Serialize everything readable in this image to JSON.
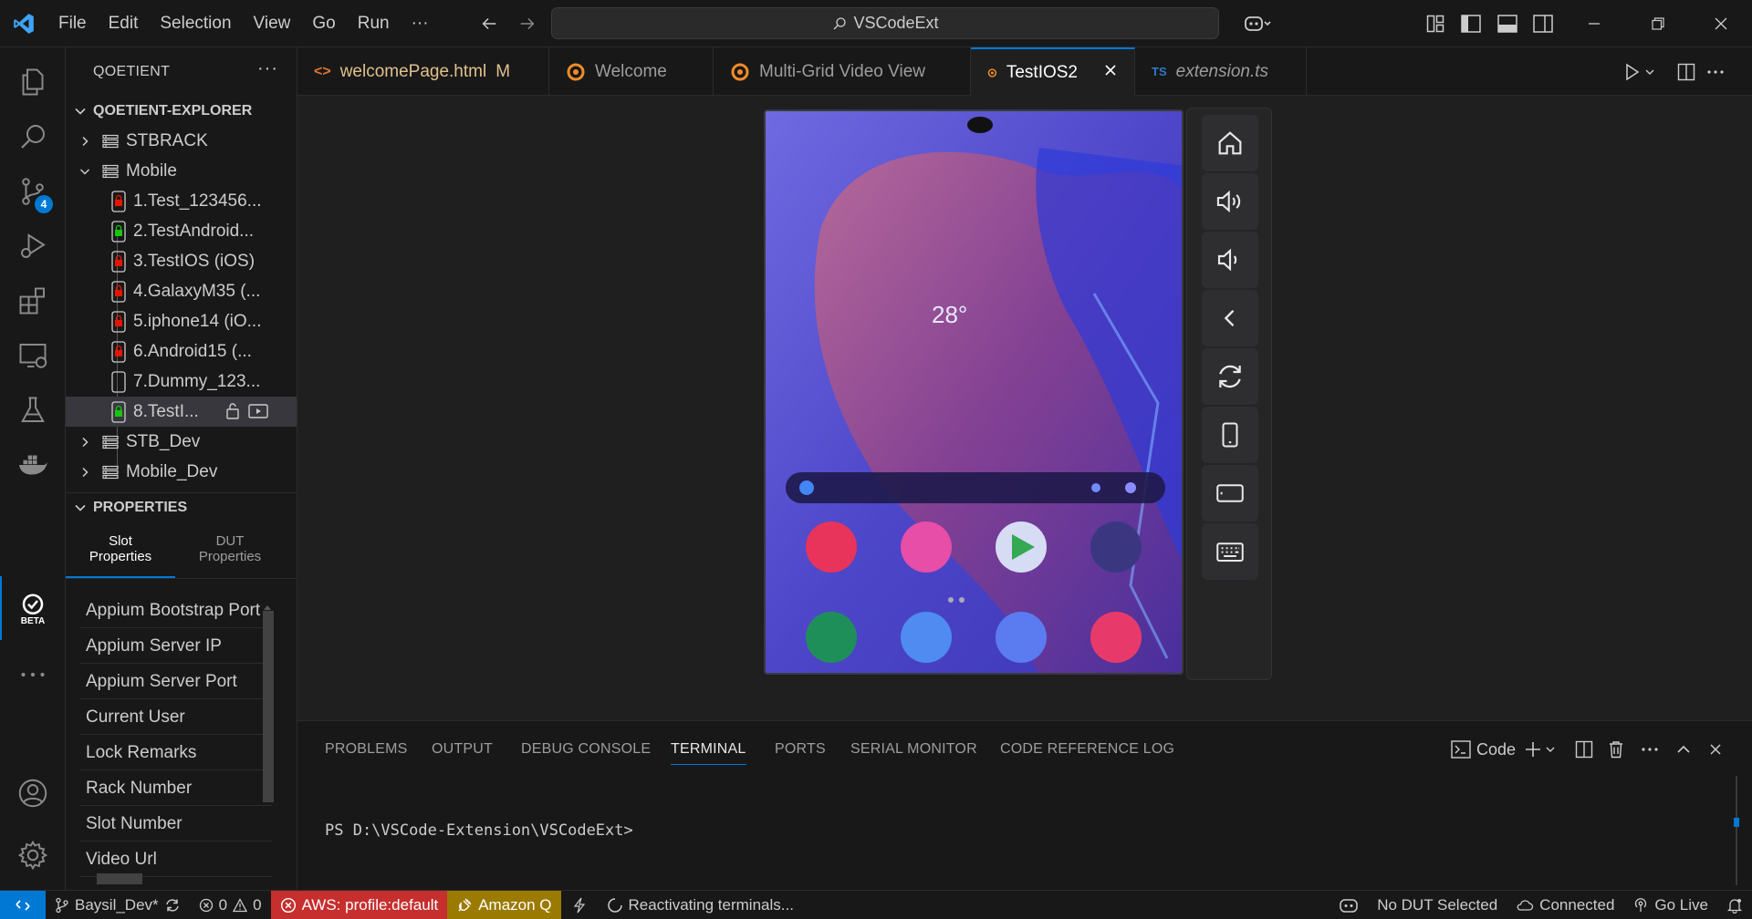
{
  "menu": [
    "File",
    "Edit",
    "Selection",
    "View",
    "Go",
    "Run",
    "···"
  ],
  "search": {
    "text": "VSCodeExt"
  },
  "activity": {
    "scm_badge": "4",
    "beta_label": "BETA"
  },
  "sidebar": {
    "title": "QOETIENT",
    "explorer_title": "QOETIENT-EXPLORER",
    "tree": [
      {
        "label": "STBRACK",
        "type": "rack",
        "expanded": false
      },
      {
        "label": "Mobile",
        "type": "rack",
        "expanded": true
      },
      {
        "label": "1.Test_123456...",
        "type": "device",
        "status": "red"
      },
      {
        "label": "2.TestAndroid...",
        "type": "device",
        "status": "green"
      },
      {
        "label": "3.TestIOS (iOS)",
        "type": "device",
        "status": "red"
      },
      {
        "label": "4.GalaxyM35 (...",
        "type": "device",
        "status": "red"
      },
      {
        "label": "5.iphone14 (iO...",
        "type": "device",
        "status": "red"
      },
      {
        "label": "6.Android15 (...",
        "type": "device",
        "status": "red"
      },
      {
        "label": "7.Dummy_123...",
        "type": "device",
        "status": "empty"
      },
      {
        "label": "8.TestI...",
        "type": "device",
        "status": "green",
        "selected": true
      },
      {
        "label": "STB_Dev",
        "type": "rack",
        "expanded": false
      },
      {
        "label": "Mobile_Dev",
        "type": "rack",
        "expanded": false
      }
    ],
    "properties_title": "PROPERTIES",
    "prop_tabs": [
      {
        "line1": "Slot",
        "line2": "Properties",
        "active": true
      },
      {
        "line1": "DUT",
        "line2": "Properties",
        "active": false
      }
    ],
    "properties": [
      "Appium Bootstrap Port",
      "Appium Server IP",
      "Appium Server Port",
      "Current User",
      "Lock Remarks",
      "Rack Number",
      "Slot Number",
      "Video Url"
    ]
  },
  "tabs": [
    {
      "label": "welcomePage.html",
      "suffix": "M",
      "icon": "html-icon",
      "active": false
    },
    {
      "label": "Welcome",
      "icon": "qoetient-icon",
      "active": false
    },
    {
      "label": "Multi-Grid Video View",
      "icon": "qoetient-icon",
      "active": false
    },
    {
      "label": "TestIOS2",
      "icon": "qoetient-icon",
      "active": true
    },
    {
      "label": "extension.ts",
      "icon": "ts-icon",
      "prefix": "TS",
      "active": false
    }
  ],
  "phone": {
    "weather_temp": "28°"
  },
  "controls": [
    "home-icon",
    "volume-up-icon",
    "volume-down-icon",
    "back-icon",
    "rotate-icon",
    "portrait-icon",
    "landscape-icon",
    "keyboard-icon"
  ],
  "panel": {
    "tabs": [
      "PROBLEMS",
      "OUTPUT",
      "DEBUG CONSOLE",
      "TERMINAL",
      "PORTS",
      "SERIAL MONITOR",
      "CODE REFERENCE LOG"
    ],
    "active_tab": "TERMINAL",
    "terminal_profile": "Code",
    "terminal_line": "PS D:\\VSCode-Extension\\VSCodeExt>"
  },
  "status": {
    "branch": "Baysil_Dev*",
    "errors": "0",
    "warnings": "0",
    "aws": "AWS: profile:default",
    "amazonq": "Amazon Q",
    "reactivating": "Reactivating terminals...",
    "dut": "No DUT Selected",
    "connected": "Connected",
    "golive": "Go Live"
  },
  "colors": {
    "accent": "#0078d4",
    "aws_bg": "#c72e2e",
    "amazonq_bg": "#9b7a00",
    "remote_bg": "#0078d4"
  }
}
